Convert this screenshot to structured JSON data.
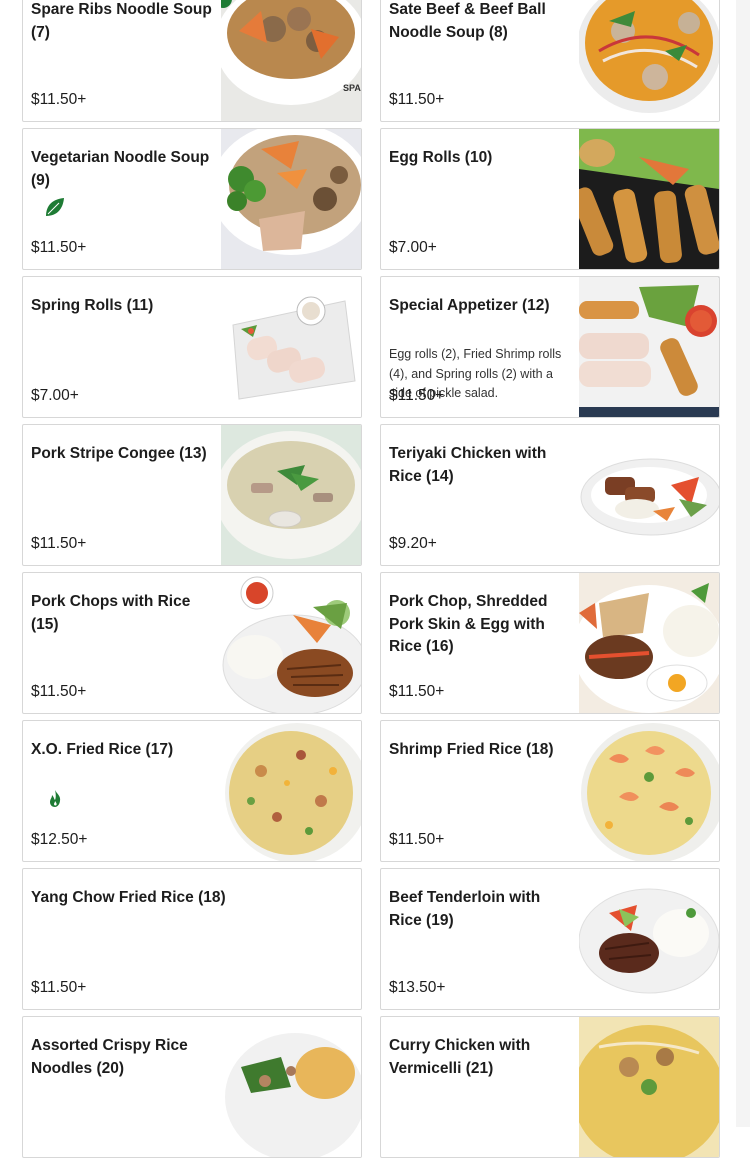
{
  "menu_items": [
    {
      "title": "Spare Ribs Noodle Soup (7)",
      "price": "$11.50+",
      "photo_label": "SPAR"
    },
    {
      "title": "Sate Beef & Beef Ball Noodle Soup (8)",
      "price": "$11.50+"
    },
    {
      "title": "Vegetarian Noodle Soup (9)",
      "price": "$11.50+",
      "badge": "leaf-icon"
    },
    {
      "title": "Egg Rolls (10)",
      "price": "$7.00+"
    },
    {
      "title": "Spring Rolls (11)",
      "price": "$7.00+"
    },
    {
      "title": "Special Appetizer (12)",
      "description": "Egg rolls (2), Fried Shrimp rolls (4), and Spring rolls (2) with a side of pickle salad.",
      "price": "$11.50+"
    },
    {
      "title": "Pork Stripe Congee (13)",
      "price": "$11.50+"
    },
    {
      "title": "Teriyaki Chicken with Rice (14)",
      "price": "$9.20+"
    },
    {
      "title": "Pork Chops with Rice (15)",
      "price": "$11.50+"
    },
    {
      "title": "Pork Chop, Shredded Pork Skin & Egg with Rice (16)",
      "price": "$11.50+"
    },
    {
      "title": "X.O. Fried Rice (17)",
      "price": "$12.50+",
      "badge": "flame-icon"
    },
    {
      "title": "Shrimp Fried Rice (18)",
      "price": "$11.50+"
    },
    {
      "title": "Yang Chow Fried Rice (18)",
      "price": "$11.50+"
    },
    {
      "title": "Beef Tenderloin with Rice (19)",
      "price": "$13.50+"
    },
    {
      "title": "Assorted Crispy Rice Noodles (20)",
      "price": ""
    },
    {
      "title": "Curry Chicken with Vermicelli (21)",
      "price": ""
    }
  ],
  "colors": {
    "badge_green": "#1e7b34",
    "card_border": "#d7d7d7",
    "text": "#1d1d1d"
  }
}
